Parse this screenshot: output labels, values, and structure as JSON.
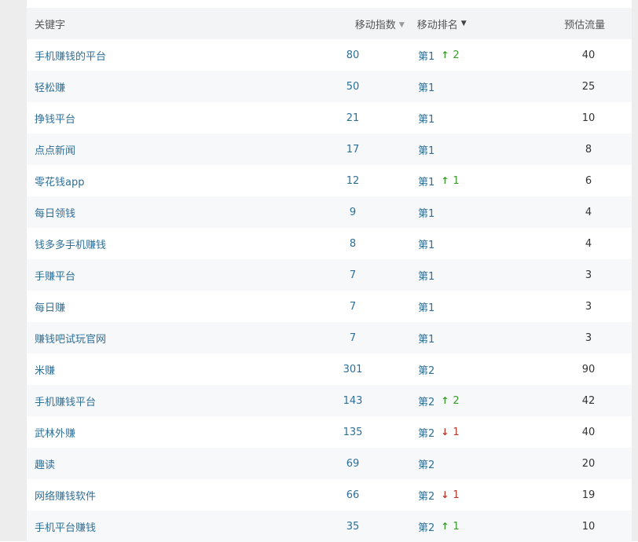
{
  "header": {
    "keyword": "关键字",
    "mobile_index": "移动指数",
    "mobile_rank": "移动排名",
    "est_traffic": "预估流量"
  },
  "rows": [
    {
      "keyword": "手机赚钱的平台",
      "index": "80",
      "rank": "第1",
      "change_dir": "up",
      "change": "2",
      "traffic": "40"
    },
    {
      "keyword": "轻松赚",
      "index": "50",
      "rank": "第1",
      "change_dir": "",
      "change": "",
      "traffic": "25"
    },
    {
      "keyword": "挣钱平台",
      "index": "21",
      "rank": "第1",
      "change_dir": "",
      "change": "",
      "traffic": "10"
    },
    {
      "keyword": "点点新闻",
      "index": "17",
      "rank": "第1",
      "change_dir": "",
      "change": "",
      "traffic": "8"
    },
    {
      "keyword": "零花钱app",
      "index": "12",
      "rank": "第1",
      "change_dir": "up",
      "change": "1",
      "traffic": "6"
    },
    {
      "keyword": "每日领钱",
      "index": "9",
      "rank": "第1",
      "change_dir": "",
      "change": "",
      "traffic": "4"
    },
    {
      "keyword": "钱多多手机赚钱",
      "index": "8",
      "rank": "第1",
      "change_dir": "",
      "change": "",
      "traffic": "4"
    },
    {
      "keyword": "手赚平台",
      "index": "7",
      "rank": "第1",
      "change_dir": "",
      "change": "",
      "traffic": "3"
    },
    {
      "keyword": "每日赚",
      "index": "7",
      "rank": "第1",
      "change_dir": "",
      "change": "",
      "traffic": "3"
    },
    {
      "keyword": "赚钱吧试玩官网",
      "index": "7",
      "rank": "第1",
      "change_dir": "",
      "change": "",
      "traffic": "3"
    },
    {
      "keyword": "米赚",
      "index": "301",
      "rank": "第2",
      "change_dir": "",
      "change": "",
      "traffic": "90"
    },
    {
      "keyword": "手机赚钱平台",
      "index": "143",
      "rank": "第2",
      "change_dir": "up",
      "change": "2",
      "traffic": "42"
    },
    {
      "keyword": "武林外赚",
      "index": "135",
      "rank": "第2",
      "change_dir": "down",
      "change": "1",
      "traffic": "40"
    },
    {
      "keyword": "趣读",
      "index": "69",
      "rank": "第2",
      "change_dir": "",
      "change": "",
      "traffic": "20"
    },
    {
      "keyword": "网络赚钱软件",
      "index": "66",
      "rank": "第2",
      "change_dir": "down",
      "change": "1",
      "traffic": "19"
    },
    {
      "keyword": "手机平台赚钱",
      "index": "35",
      "rank": "第2",
      "change_dir": "up",
      "change": "1",
      "traffic": "10"
    }
  ],
  "icons": {
    "sort_caret": "caret-down-icon",
    "up": "arrow-up-icon",
    "down": "arrow-down-icon"
  },
  "colors": {
    "link": "#2d6f97",
    "up": "#3a9a2a",
    "down": "#b03a2e",
    "header_bg": "#f3f4f6",
    "alt_row_bg": "#f7f8fa"
  }
}
